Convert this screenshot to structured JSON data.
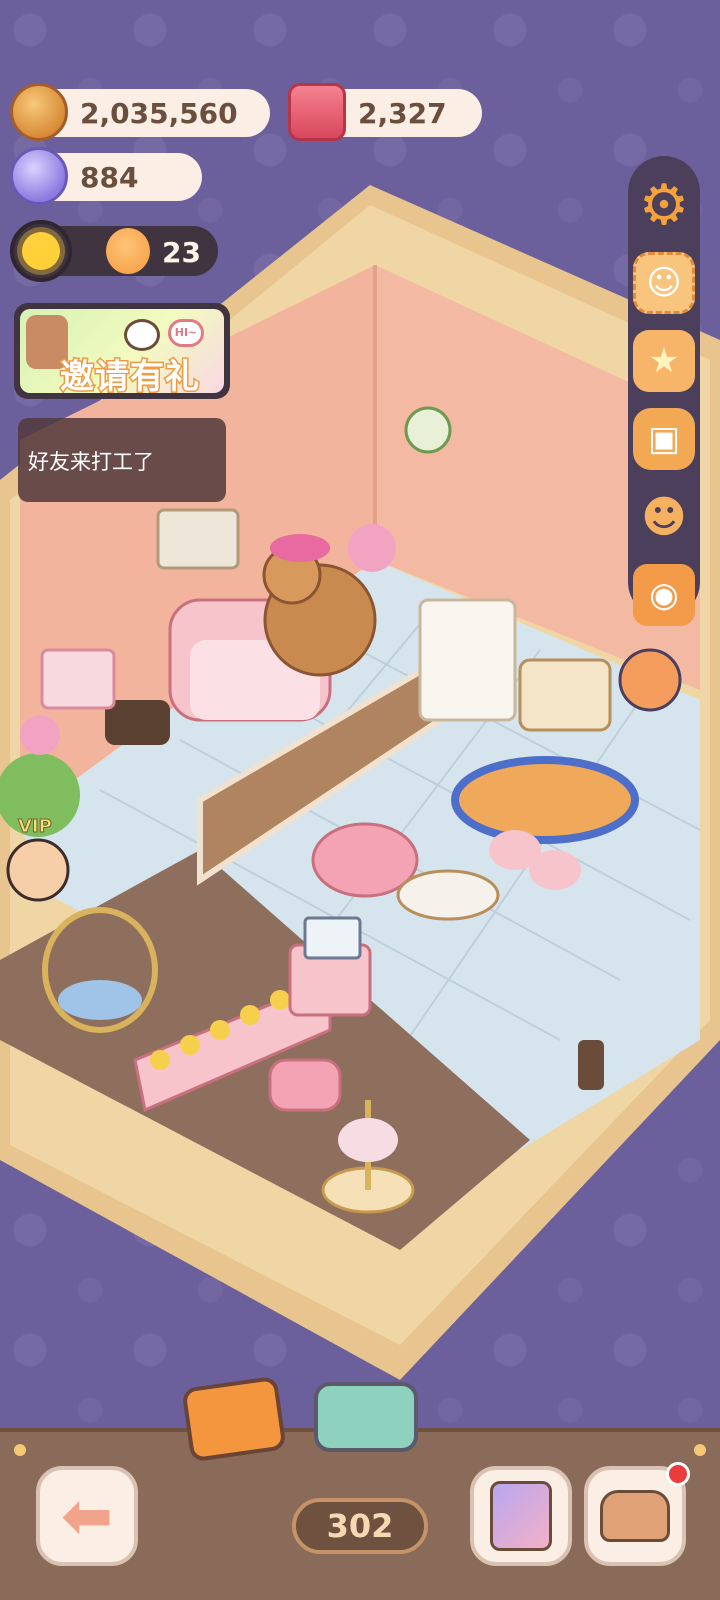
{
  "currency": {
    "coins": "2,035,560",
    "gems": "2,327",
    "candies": "884"
  },
  "sun": {
    "count": "23"
  },
  "invite": {
    "label": "邀请有礼",
    "bubble_text": "HI~"
  },
  "friends_work": {
    "text": "好友来打工了"
  },
  "room": {
    "vip_label": "VIP"
  },
  "sidebar": {
    "items": [
      {
        "name": "settings",
        "icon": "gear-icon"
      },
      {
        "name": "stamp-collection",
        "icon": "stamp-icon"
      },
      {
        "name": "star-shop",
        "icon": "star-icon"
      },
      {
        "name": "backpack",
        "icon": "bag-icon"
      },
      {
        "name": "friends",
        "icon": "friends-icon"
      },
      {
        "name": "camera",
        "icon": "camera-icon"
      }
    ]
  },
  "bottom": {
    "level": "302"
  },
  "colors": {
    "background": "#6b5f9c",
    "pill": "#fbeee4",
    "accent_orange": "#f5a13c",
    "bottom_bar": "#8a6a58"
  }
}
